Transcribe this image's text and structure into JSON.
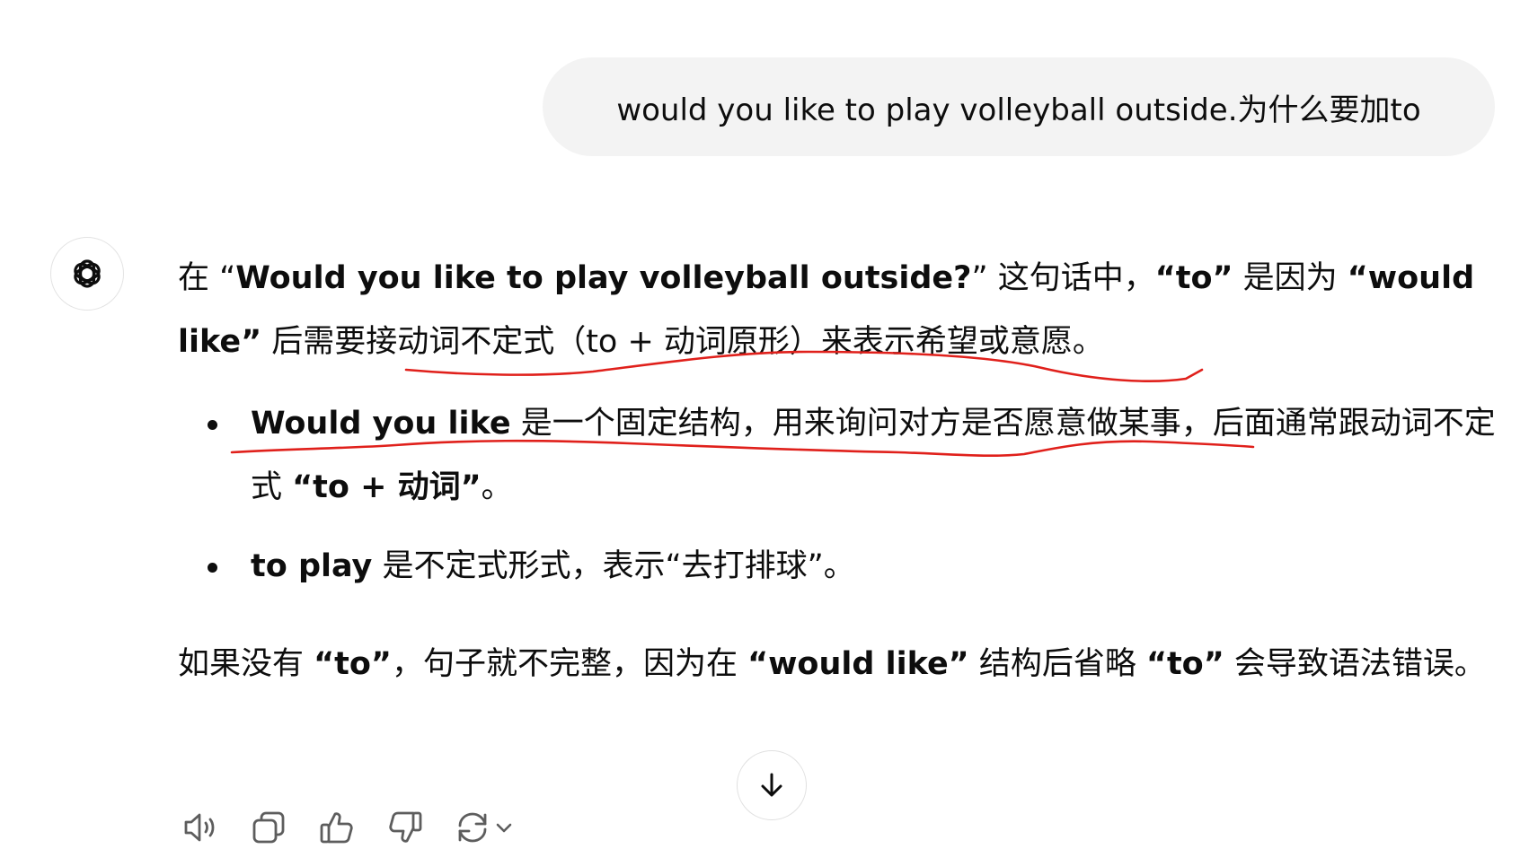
{
  "user_message": "would you like to play volleyball outside.为什么要加to",
  "assistant": {
    "avatar_icon": "openai-logo-icon",
    "para1": {
      "t1": "在 “",
      "b1": "Would you like to play volleyball outside?",
      "t2": "” 这句话中，",
      "b2": "“to”",
      "t3": " 是因为 ",
      "b3": "“would like”",
      "t4": " 后需要接动词不定式（to + 动词原形）来表示希望或意愿。"
    },
    "bullets": [
      {
        "bold": "Would you like",
        "text": " 是一个固定结构，用来询问对方是否愿意做某事，后面通常跟动词不定式 ",
        "bold2": "“to + 动词”",
        "text2": "。"
      },
      {
        "bold": "to play",
        "text": " 是不定式形式，表示“去打排球”。"
      }
    ],
    "para3": {
      "t1": "如果没有 ",
      "b1": "“to”",
      "t2": "，句子就不完整，因为在 ",
      "b2": "“would like”",
      "t3": " 结构后省略 ",
      "b3": "“to”",
      "t4": " 会导致语法错误。"
    }
  },
  "annotation_color": "#e0201b",
  "scroll_button_icon": "arrow-down-icon",
  "actions": [
    {
      "icon": "read-aloud-icon"
    },
    {
      "icon": "copy-icon"
    },
    {
      "icon": "thumbs-up-icon"
    },
    {
      "icon": "thumbs-down-icon"
    },
    {
      "icon": "regenerate-icon"
    }
  ]
}
